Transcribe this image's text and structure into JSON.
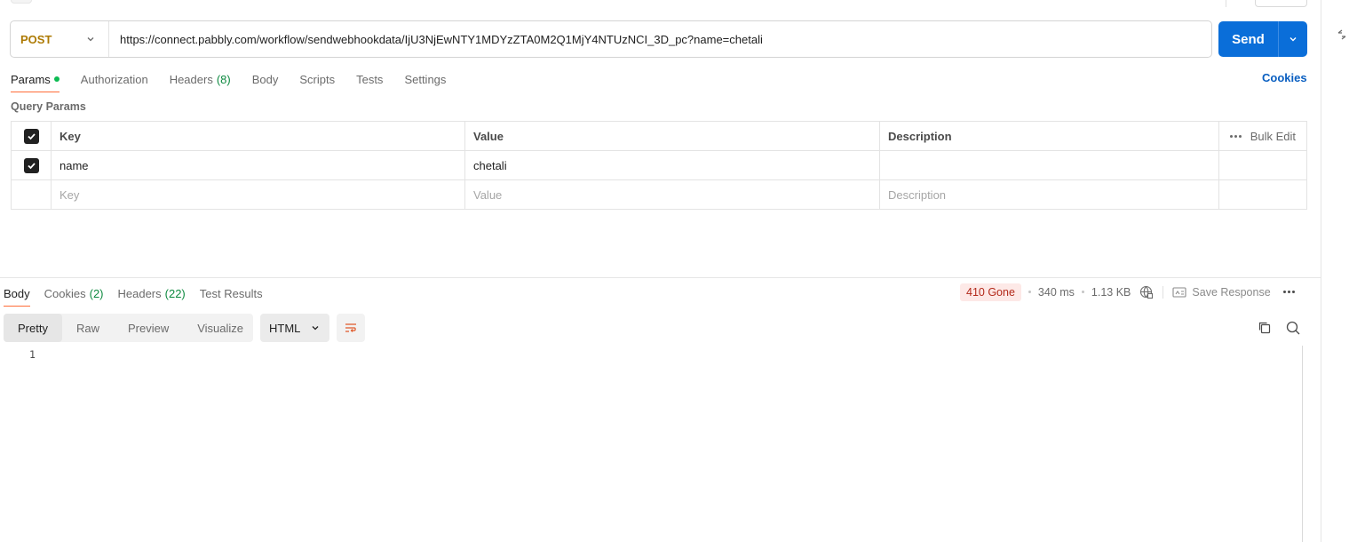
{
  "request": {
    "method": "POST",
    "url": "https://connect.pabbly.com/workflow/sendwebhookdata/IjU3NjEwNTY1MDYzZTA0M2Q1MjY4NTUzNCI_3D_pc?name=chetali",
    "send_label": "Send"
  },
  "tabs": [
    {
      "label": "Params",
      "active": true,
      "indicator": "green-dot"
    },
    {
      "label": "Authorization"
    },
    {
      "label": "Headers",
      "count": "(8)"
    },
    {
      "label": "Body"
    },
    {
      "label": "Scripts"
    },
    {
      "label": "Tests"
    },
    {
      "label": "Settings"
    }
  ],
  "cookies_label": "Cookies",
  "query_params": {
    "title": "Query Params",
    "headers": {
      "key": "Key",
      "value": "Value",
      "description": "Description",
      "bulk_edit": "Bulk Edit"
    },
    "rows": [
      {
        "checked": true,
        "key": "name",
        "value": "chetali",
        "description": ""
      }
    ],
    "placeholders": {
      "key": "Key",
      "value": "Value",
      "description": "Description"
    }
  },
  "response": {
    "tabs": [
      {
        "label": "Body",
        "active": true
      },
      {
        "label": "Cookies",
        "count": "(2)"
      },
      {
        "label": "Headers",
        "count": "(22)"
      },
      {
        "label": "Test Results"
      }
    ],
    "status": "410 Gone",
    "time": "340 ms",
    "size": "1.13 KB",
    "save_label": "Save Response",
    "views": [
      "Pretty",
      "Raw",
      "Preview",
      "Visualize"
    ],
    "active_view": "Pretty",
    "format": "HTML",
    "line_number": "1"
  },
  "colors": {
    "method": "#ad7a03",
    "send": "#0a6ed9",
    "active_tab_underline": "#ff6c37",
    "status_bg": "#fde9e7",
    "status_text": "#b32a1b",
    "count": "#0e8a40",
    "link": "#0a5fc1"
  }
}
